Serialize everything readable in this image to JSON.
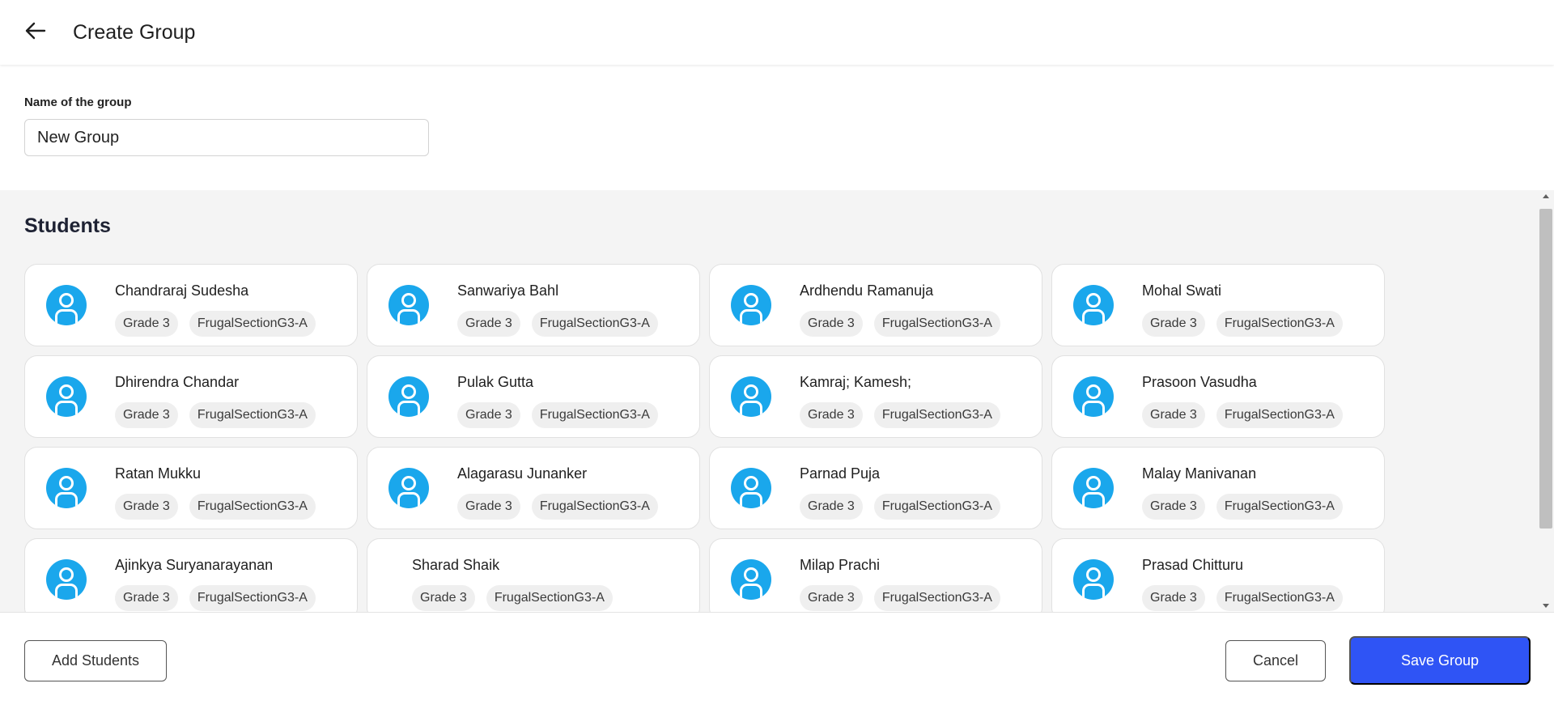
{
  "header": {
    "title": "Create Group",
    "back_icon": "arrow-left-icon"
  },
  "form": {
    "name_label": "Name of the group",
    "name_value": "New Group"
  },
  "students": {
    "title": "Students",
    "items": [
      {
        "name": "Chandraraj Sudesha",
        "grade": "Grade 3",
        "section": "FrugalSectionG3-A",
        "avatar": true
      },
      {
        "name": "Sanwariya Bahl",
        "grade": "Grade 3",
        "section": "FrugalSectionG3-A",
        "avatar": true
      },
      {
        "name": "Ardhendu Ramanuja",
        "grade": "Grade 3",
        "section": "FrugalSectionG3-A",
        "avatar": true
      },
      {
        "name": "Mohal Swati",
        "grade": "Grade 3",
        "section": "FrugalSectionG3-A",
        "avatar": true
      },
      {
        "name": "Dhirendra Chandar",
        "grade": "Grade 3",
        "section": "FrugalSectionG3-A",
        "avatar": true
      },
      {
        "name": "Pulak Gutta",
        "grade": "Grade 3",
        "section": "FrugalSectionG3-A",
        "avatar": true
      },
      {
        "name": "Kamraj; Kamesh;",
        "grade": "Grade 3",
        "section": "FrugalSectionG3-A",
        "avatar": true
      },
      {
        "name": "Prasoon Vasudha",
        "grade": "Grade 3",
        "section": "FrugalSectionG3-A",
        "avatar": true
      },
      {
        "name": "Ratan Mukku",
        "grade": "Grade 3",
        "section": "FrugalSectionG3-A",
        "avatar": true
      },
      {
        "name": "Alagarasu Junanker",
        "grade": "Grade 3",
        "section": "FrugalSectionG3-A",
        "avatar": true
      },
      {
        "name": "Parnad Puja",
        "grade": "Grade 3",
        "section": "FrugalSectionG3-A",
        "avatar": true
      },
      {
        "name": "Malay Manivanan",
        "grade": "Grade 3",
        "section": "FrugalSectionG3-A",
        "avatar": true
      },
      {
        "name": "Ajinkya Suryanarayanan",
        "grade": "Grade 3",
        "section": "FrugalSectionG3-A",
        "avatar": true
      },
      {
        "name": "Sharad Shaik",
        "grade": "Grade 3",
        "section": "FrugalSectionG3-A",
        "avatar": false
      },
      {
        "name": "Milap Prachi",
        "grade": "Grade 3",
        "section": "FrugalSectionG3-A",
        "avatar": true
      },
      {
        "name": "Prasad Chitturu",
        "grade": "Grade 3",
        "section": "FrugalSectionG3-A",
        "avatar": true
      }
    ]
  },
  "footer": {
    "add_label": "Add Students",
    "cancel_label": "Cancel",
    "save_label": "Save Group"
  },
  "colors": {
    "accent": "#2f54f5",
    "avatar": "#1aa7ec",
    "panel_bg": "#f4f4f4"
  }
}
